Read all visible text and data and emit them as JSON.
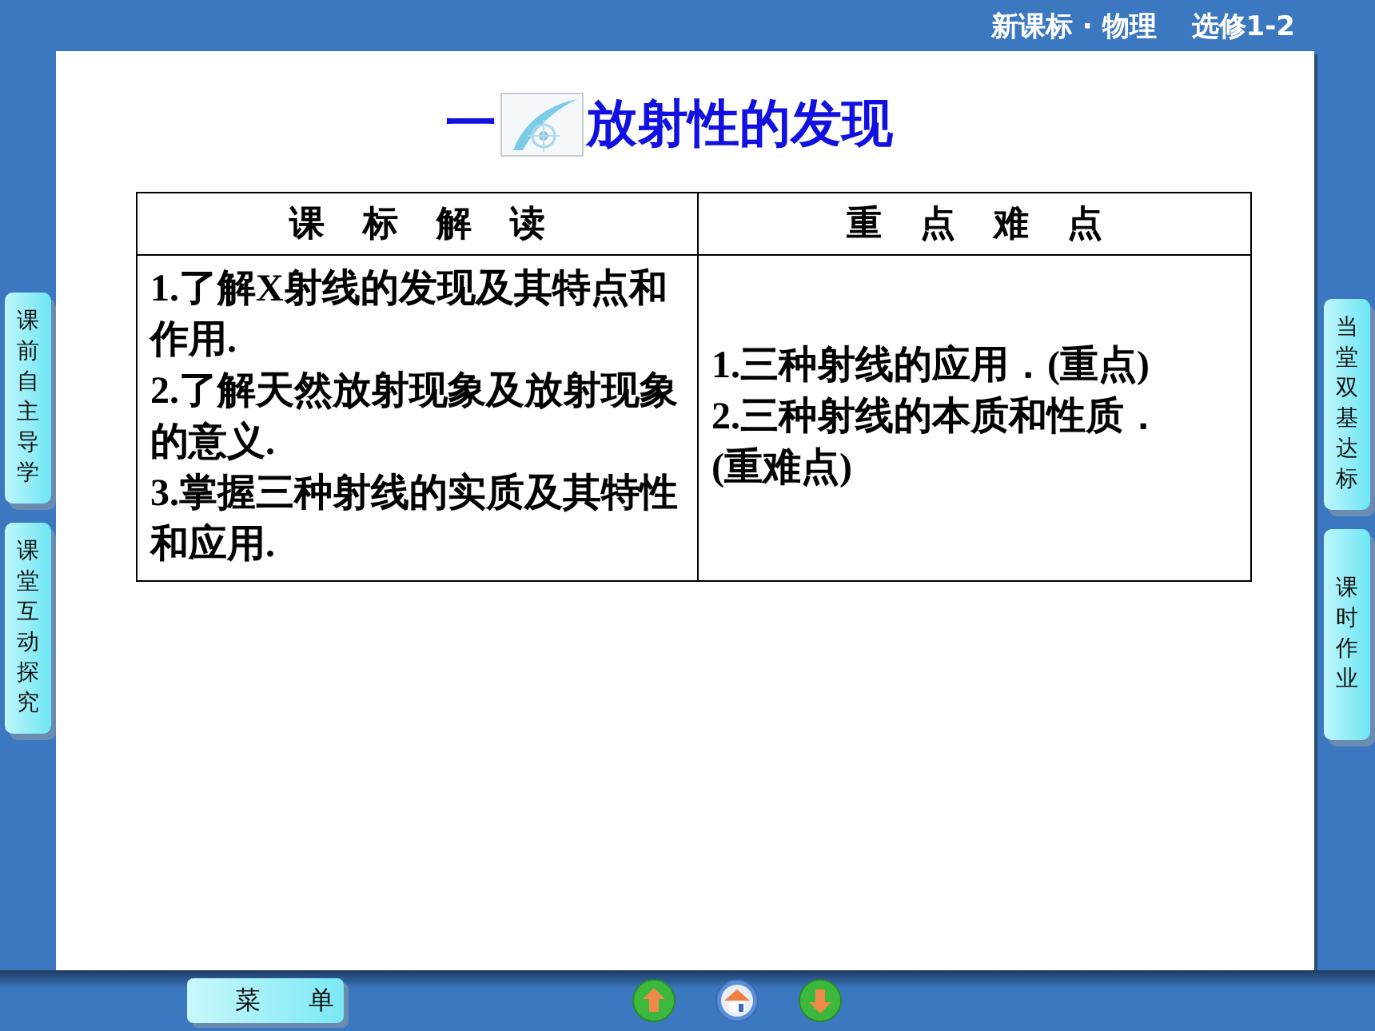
{
  "header": {
    "course": "新课标 · 物理",
    "module": "选修1-2"
  },
  "title": {
    "number": "一",
    "text": "放射性的发现"
  },
  "table": {
    "columns": [
      "课标解读",
      "重点难点"
    ],
    "cells": [
      [
        "1.了解X射线的发现及其特点和作用.",
        "2.了解天然放射现象及放射现象的意义.",
        "3.掌握三种射线的实质及其特性和应用."
      ],
      [
        "1.三种射线的应用．(重点)",
        "2.三种射线的本质和性质．(重难点)"
      ]
    ]
  },
  "left_tabs": [
    "课前自主导学",
    "课堂互动探究"
  ],
  "right_tabs": [
    "当堂双基达标",
    "课时作业"
  ],
  "menu": "菜单",
  "nav": [
    {
      "kind": "up"
    },
    {
      "kind": "home"
    },
    {
      "kind": "down"
    }
  ]
}
